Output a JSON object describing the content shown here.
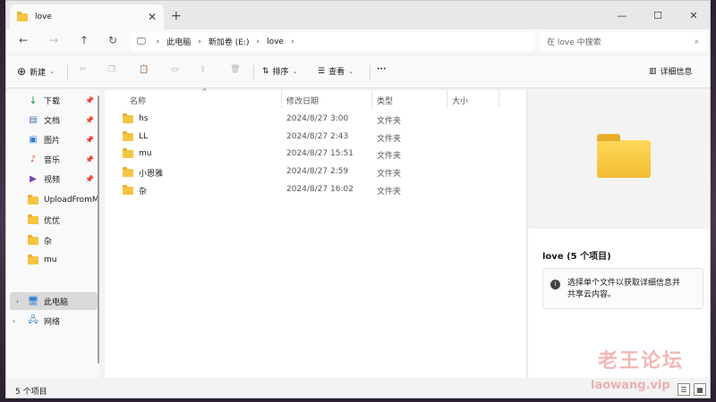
{
  "tab": {
    "title": "love",
    "close": "✕",
    "new_tab": "+"
  },
  "window_controls": {
    "minimize": "—",
    "maximize": "☐",
    "close": "✕"
  },
  "nav": {
    "back": "←",
    "forward": "→",
    "up": "↑",
    "refresh": "↻",
    "breadcrumb": [
      "此电脑",
      "新加卷 (E:)",
      "love"
    ],
    "search_placeholder": "在 love 中搜索"
  },
  "commands": {
    "new": "新建",
    "sort": "排序",
    "view": "查看",
    "more": "···",
    "details": "详细信息"
  },
  "sidebar": {
    "quick": [
      {
        "label": "下载",
        "icon": "download-icon",
        "pinned": true
      },
      {
        "label": "文档",
        "icon": "document-icon",
        "pinned": true
      },
      {
        "label": "图片",
        "icon": "picture-icon",
        "pinned": true
      },
      {
        "label": "音乐",
        "icon": "music-icon",
        "pinned": true
      },
      {
        "label": "视频",
        "icon": "video-icon",
        "pinned": true
      },
      {
        "label": "UploadFromM",
        "icon": "folder-icon",
        "pinned": false
      },
      {
        "label": "优优",
        "icon": "folder-icon",
        "pinned": false
      },
      {
        "label": "杂",
        "icon": "folder-icon",
        "pinned": false
      },
      {
        "label": "mu",
        "icon": "folder-icon",
        "pinned": false
      }
    ],
    "this_pc": "此电脑",
    "network": "网络"
  },
  "columns": {
    "name": "名称",
    "date": "修改日期",
    "type": "类型",
    "size": "大小"
  },
  "files": [
    {
      "name": "hs",
      "date": "2024/8/27 3:00",
      "type": "文件夹"
    },
    {
      "name": "LL",
      "date": "2024/8/27 2:43",
      "type": "文件夹"
    },
    {
      "name": "mu",
      "date": "2024/8/27 15:51",
      "type": "文件夹"
    },
    {
      "name": "小恩雅",
      "date": "2024/8/27 2:59",
      "type": "文件夹"
    },
    {
      "name": "杂",
      "date": "2024/8/27 16:02",
      "type": "文件夹"
    }
  ],
  "details_pane": {
    "title": "love (5 个项目)",
    "info_line1": "选择单个文件以获取详细信息并",
    "info_line2": "共享云内容。"
  },
  "status": {
    "count": "5 个项目"
  },
  "watermark": {
    "line1": "老王论坛",
    "line2": "laowang.vip"
  },
  "colors": {
    "folder": "#f4c542",
    "accent": "#0067c0"
  }
}
